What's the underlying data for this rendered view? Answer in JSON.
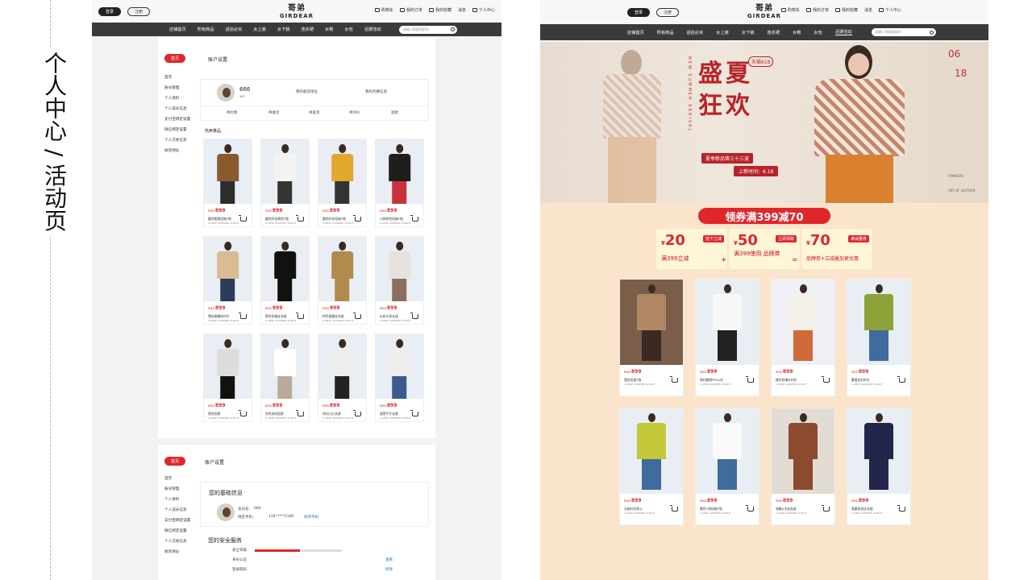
{
  "caption": {
    "text": "个人中心 / 活动页"
  },
  "topbar": {
    "login": "登录",
    "register": "注册",
    "brand": "GIRDEAR",
    "brand_mark": "哥弟",
    "links": [
      "购物车",
      "我的订单",
      "我的收藏",
      "消息",
      "个人中心"
    ]
  },
  "mainnav": {
    "items": [
      "店铺首页",
      "所有商品",
      "进店必买",
      "女上装",
      "女下装",
      "连衣裙",
      "女鞋",
      "女包",
      "近期活动"
    ],
    "search_placeholder": "请输入想要搜索的"
  },
  "account1": {
    "home_tag": "首页",
    "title": "账户设置",
    "menu": [
      "首页",
      "账号管理",
      "个人资料",
      "个人成长信息",
      "支付宝绑定设置",
      "微信绑定设置",
      "个人交易信息",
      "收货地址"
    ],
    "username": "666",
    "vip": "487",
    "addr_link": "我的收货地址",
    "benefit_link": "我的优惠信息",
    "order_tabs": [
      "待付款",
      "待收货",
      "待发货",
      "待评价",
      "退款"
    ],
    "hot_label": "热卖推品"
  },
  "products1": {
    "price_unit": "RMB",
    "price": "899",
    "sub": "A NEW SUMMER SHOUT",
    "names": [
      "圆领图案短袖T恤",
      "圆领印花棉质T恤",
      "圆领印花短袖T恤",
      "口袋拼色短袖T恤",
      "雪纺蝴蝶结衬衫",
      "黑色短袖连衣裙",
      "棕色收腰连衣裙",
      "纱质半身长裙",
      "黑色短裤",
      "灰色休闲短裤",
      "休闲九分长裤",
      "直筒牛仔长裤"
    ]
  },
  "account2": {
    "home_tag": "首页",
    "title": "账户设置",
    "menu": [
      "首页",
      "账号管理",
      "个人资料",
      "个人成长信息",
      "支付宝绑定设置",
      "微信绑定设置",
      "个人交易信息",
      "收货地址"
    ],
    "basic_title": "您的基础信息",
    "member_label": "会员名：",
    "member_value": "666",
    "phone_label": "绑定手机：",
    "phone_value": "134*****2100",
    "phone_edit": "修改手机",
    "security_title": "您的安全服务",
    "security_level": "安全等级：",
    "items": [
      "身份认证",
      "登录密码"
    ],
    "item_actions": [
      "查看",
      "修改"
    ]
  },
  "banner": {
    "title1": "盛夏",
    "title2": "狂欢",
    "tmall": "天猫618",
    "subtitle": "NEW SUMMER ARRIVAL",
    "slogan": "夏季新品第三十三波",
    "date_label": "上新时间：6.18",
    "date_month": "06",
    "date_day": "18",
    "side_note": "ITAMOOD",
    "side_note2": "ART OF LEATHER"
  },
  "coupons": {
    "headline": "领券满399减70",
    "items": [
      {
        "amount": "20",
        "btn": "拍下立减",
        "desc": "满399立减"
      },
      {
        "amount": "50",
        "btn": "立即领取",
        "desc": "满399使用 品牌券"
      },
      {
        "amount": "70",
        "btn": "满减叠券",
        "desc": "品牌券+立减叠加更优惠"
      }
    ],
    "plus": "+",
    "eq": "="
  },
  "products2": {
    "price_unit": "RMB",
    "price": "899",
    "sub": "A NEW SUMMER SHOUT",
    "names": [
      "宽松短袖T恤",
      "简约翻领POLO衫",
      "镂空短袖针织衫",
      "桑蚕丝针织衫",
      "无袖针织背心",
      "黄色V领短袖T恤",
      "收腰A字连衣裙",
      "高腰修身连衣裙"
    ]
  },
  "colors": {
    "accent": "#e0262c",
    "nav": "#3a3a3a",
    "promo_bg": "#fbe4cc"
  }
}
